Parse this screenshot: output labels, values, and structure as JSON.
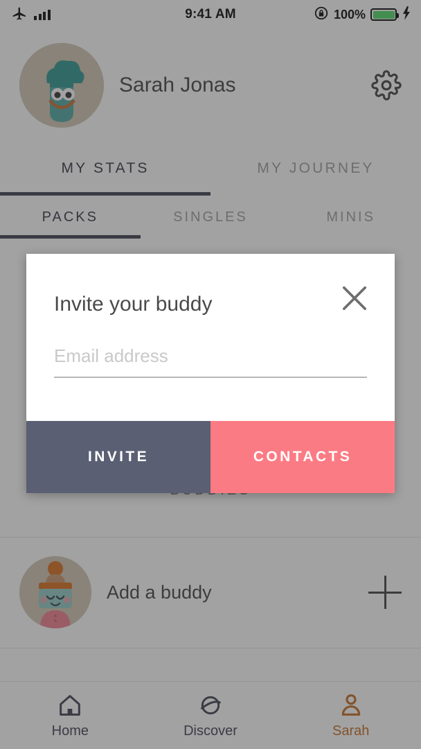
{
  "status_bar": {
    "airplane_icon": "airplane-mode-icon",
    "signal_icon": "signal-bars-icon",
    "time": "9:41 AM",
    "rotation_lock_icon": "rotation-lock-icon",
    "battery_percent": "100%",
    "battery_icon": "battery-full-icon",
    "charging_icon": "charging-bolt-icon",
    "battery_color": "#4cd964"
  },
  "profile": {
    "avatar_icon": "user-avatar-illustration",
    "name": "Sarah Jonas",
    "settings_icon": "gear-icon"
  },
  "tabs_primary": {
    "items": [
      {
        "label": "MY STATS",
        "active": true
      },
      {
        "label": "MY JOURNEY",
        "active": false
      }
    ],
    "indicator_color": "#3a3a4d"
  },
  "tabs_secondary": {
    "items": [
      {
        "label": "PACKS",
        "active": true
      },
      {
        "label": "SINGLES",
        "active": false
      },
      {
        "label": "MINIS",
        "active": false
      }
    ],
    "indicator_color": "#3a3a4d"
  },
  "buddies_section": {
    "title": "BUDDIES",
    "add_buddy": {
      "avatar_icon": "buddy-avatar-illustration",
      "label": "Add a buddy",
      "add_icon": "plus-icon"
    }
  },
  "bottom_nav": {
    "items": [
      {
        "label": "Home",
        "icon": "home-icon",
        "active": false
      },
      {
        "label": "Discover",
        "icon": "planet-icon",
        "active": false
      },
      {
        "label": "Sarah",
        "icon": "person-icon",
        "active": true
      }
    ],
    "active_color": "#c2691e"
  },
  "modal": {
    "title": "Invite your buddy",
    "close_icon": "close-icon",
    "email_field": {
      "placeholder": "Email address",
      "value": ""
    },
    "invite_label": "INVITE",
    "contacts_label": "CONTACTS",
    "invite_color": "#5a5f73",
    "contacts_color": "#fb7b84"
  }
}
